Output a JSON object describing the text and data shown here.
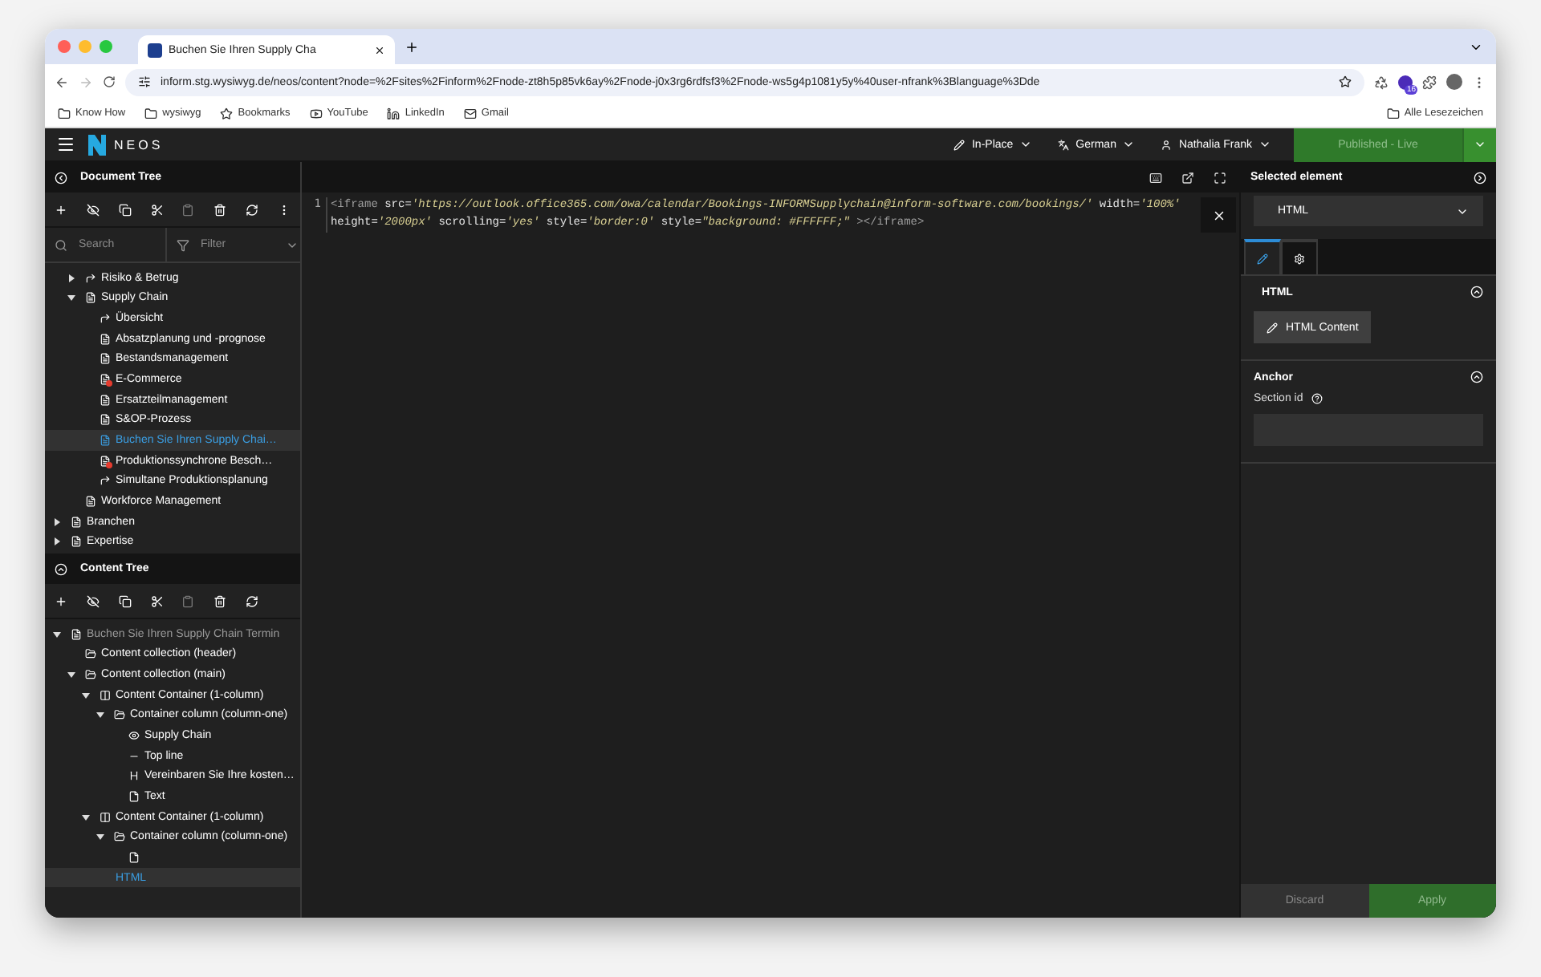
{
  "browser": {
    "tab_title": "Buchen Sie Ihren Supply Cha",
    "url": "inform.stg.wysiwyg.de/neos/content?node=%2Fsites%2Finform%2Fnode-zt8h5p85vk6ay%2Fnode-j0x3rg6rdfsf3%2Fnode-ws5g4p1081y5y%40user-nfrank%3Blanguage%3Dde",
    "extension_badge": "16",
    "bookmarks": [
      {
        "label": "Know How",
        "kind": "folder"
      },
      {
        "label": "wysiwyg",
        "kind": "folder"
      },
      {
        "label": "Bookmarks",
        "kind": "star"
      },
      {
        "label": "YouTube",
        "kind": "youtube"
      },
      {
        "label": "LinkedIn",
        "kind": "linkedin"
      },
      {
        "label": "Gmail",
        "kind": "gmail"
      }
    ],
    "other_bookmarks": "Alle Lesezeichen"
  },
  "topbar": {
    "logo": "NEOS",
    "menus": [
      {
        "label": "In-Place",
        "kind": "edit"
      },
      {
        "label": "German",
        "kind": "language"
      },
      {
        "label": "Nathalia Frank",
        "kind": "user"
      }
    ],
    "publish": "Published - Live"
  },
  "document_tree": {
    "title": "Document Tree",
    "search_placeholder": "Search",
    "filter_placeholder": "Filter",
    "nodes": [
      {
        "children": [
          {
            "label": "Risiko & Betrug",
            "kind": "shortcut",
            "expanded": false,
            "selected": false
          },
          {
            "label": "Supply Chain",
            "kind": "page",
            "expanded": true,
            "selected": false,
            "children": [
              {
                "label": "Übersicht",
                "kind": "shortcut",
                "selected": false
              },
              {
                "label": "Absatzplanung und -prognose",
                "kind": "page",
                "selected": false
              },
              {
                "label": "Bestandsmanagement",
                "kind": "page",
                "selected": false
              },
              {
                "label": "E-Commerce",
                "kind": "page-marked",
                "selected": false
              },
              {
                "label": "Ersatzteilmanagement",
                "kind": "page",
                "selected": false
              },
              {
                "label": "S&OP-Prozess",
                "kind": "page",
                "selected": false
              },
              {
                "label": "Buchen Sie Ihren Supply Chai…",
                "kind": "page",
                "selected": true
              },
              {
                "label": "Produktionssynchrone Besch…",
                "kind": "page-marked",
                "selected": false
              },
              {
                "label": "Simultane Produktionsplanung",
                "kind": "shortcut",
                "selected": false
              }
            ]
          },
          {
            "label": "Workforce Management",
            "kind": "page",
            "selected": false
          }
        ]
      },
      {
        "label": "Branchen",
        "kind": "page",
        "expanded": false,
        "selected": false
      },
      {
        "label": "Expertise",
        "kind": "page",
        "expanded": false,
        "selected": false
      }
    ]
  },
  "content_tree": {
    "title": "Content Tree",
    "nodes": [
      {
        "label": "Buchen Sie Ihren Supply Chain Termin",
        "kind": "page",
        "expanded": true,
        "selected": false,
        "children": [
          {
            "label": "Content collection (header)",
            "kind": "folder",
            "selected": false
          },
          {
            "label": "Content collection (main)",
            "kind": "folder",
            "expanded": true,
            "selected": false,
            "children": [
              {
                "label": "Content Container (1-column)",
                "kind": "columns",
                "expanded": true,
                "selected": false,
                "children": [
                  {
                    "label": "Container column (column-one)",
                    "kind": "folder",
                    "expanded": true,
                    "selected": false,
                    "children": [
                      {
                        "label": "Supply Chain",
                        "kind": "eye",
                        "selected": false
                      },
                      {
                        "label": "Top line",
                        "kind": "line",
                        "selected": false
                      },
                      {
                        "label": "Vereinbaren Sie Ihre kosten…",
                        "kind": "heading",
                        "selected": false
                      },
                      {
                        "label": "Text",
                        "kind": "text",
                        "selected": false
                      }
                    ]
                  }
                ]
              },
              {
                "label": "Content Container (1-column)",
                "kind": "columns",
                "expanded": true,
                "selected": false,
                "children": [
                  {
                    "label": "Container column (column-one)",
                    "kind": "folder",
                    "expanded": true,
                    "selected": false,
                    "children": [
                      {
                        "kind": "text",
                        "selected": false
                      }
                    ]
                  }
                ]
              },
              {
                "label": "HTML",
                "kind": "code",
                "selected": true
              }
            ]
          }
        ]
      }
    ]
  },
  "editor": {
    "line_number": "1",
    "tokens": [
      {
        "text": "<iframe",
        "kind": "tag"
      },
      {
        "text": " src=",
        "kind": "attr"
      },
      {
        "text": "'https://outlook.office365.com/owa/calendar/Bookings-INFORMSupplychain@inform-software.com/bookings/'",
        "kind": "string"
      },
      {
        "text": " width=",
        "kind": "attr"
      },
      {
        "text": "'100%'",
        "kind": "string"
      },
      {
        "text": " height=",
        "kind": "attr"
      },
      {
        "text": "'2000px'",
        "kind": "string"
      },
      {
        "text": " scrolling=",
        "kind": "attr"
      },
      {
        "text": "'yes'",
        "kind": "string"
      },
      {
        "text": " style=",
        "kind": "attr"
      },
      {
        "text": "'border:0'",
        "kind": "string"
      },
      {
        "text": " style=",
        "kind": "attr"
      },
      {
        "text": "\"background: #FFFFFF;\"",
        "kind": "string"
      },
      {
        "text": " ></iframe>",
        "kind": "tag"
      }
    ]
  },
  "inspector": {
    "title": "Selected element",
    "element": "HTML",
    "tabs": [
      {
        "kind": "edit",
        "selected": true
      },
      {
        "kind": "settings",
        "selected": false
      }
    ],
    "sections": [
      {
        "title": "HTML",
        "kind": "button",
        "button": "HTML Content"
      },
      {
        "title": "Anchor",
        "kind": "field",
        "field_label": "Section id"
      }
    ],
    "discard": "Discard",
    "apply": "Apply"
  }
}
